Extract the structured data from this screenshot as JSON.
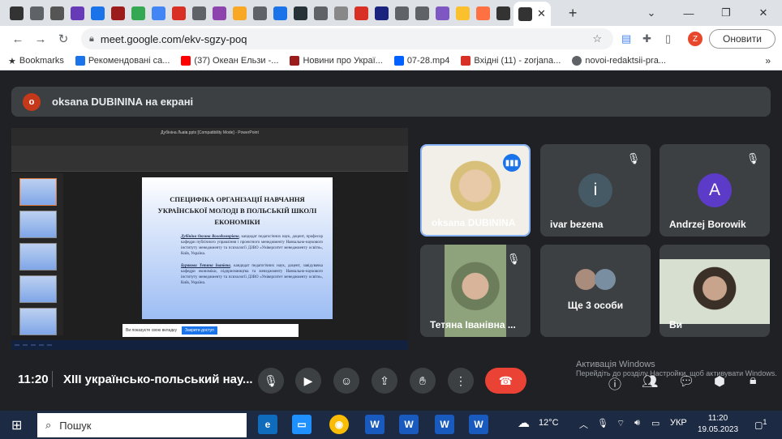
{
  "browser": {
    "url": "meet.google.com/ekv-sgzy-poq",
    "update_label": "Оновити",
    "profile_initial": "Z",
    "bookmarks": [
      {
        "label": "Bookmarks",
        "color": "#555"
      },
      {
        "label": "Рекомендовані са...",
        "color": "#1a73e8"
      },
      {
        "label": "(37) Океан Ельзи -...",
        "color": "#ff0000"
      },
      {
        "label": "Новини про Украї...",
        "color": "#9c1c1c"
      },
      {
        "label": "07-28.mp4",
        "color": "#0061fe"
      },
      {
        "label": "Вхідні (11) - zorjana...",
        "color": "#d93025"
      },
      {
        "label": "novoi-redaktsii-pra...",
        "color": "#5f6368"
      }
    ]
  },
  "meet": {
    "presenter_banner": "oksana DUBININA на екрані",
    "presenter_initial": "o",
    "time": "11:20",
    "meeting_title": "XIII українсько-польський нау...",
    "participants": [
      {
        "name": "oksana DUBININA"
      },
      {
        "name": "ivar bezena",
        "initial": "i"
      },
      {
        "name": "Andrzej Borowik",
        "initial": "A"
      },
      {
        "name": "Тетяна Іванівна ..."
      },
      {
        "name": "Ще 3 особи"
      },
      {
        "name": "Ви"
      }
    ],
    "colors": {
      "hangup": "#ea4335",
      "accent": "#1a73e8"
    }
  },
  "slide": {
    "title": "СПЕЦИФІКА ОРГАНІЗАЦІЇ НАВЧАННЯ УКРАЇНСЬКОЇ МОЛОДІ В ПОЛЬСЬКІЙ ШКОЛІ ЕКОНОМІКИ",
    "author1_name": "Дубініна Оксана Володимирівна",
    "author1_text": ", кандидат педагогічних наук, доцент, професор кафедри публічного управління і проектного менеджменту Навчально-наукового інституту менеджменту та психології ДЗВО «Університет менеджменту освіти», Київ, Україна.",
    "author2_name": "Буракова Тетяна Іванівна",
    "author2_text": ", кандидат педагогічних наук, доцент, завідувачка кафедри економіки, підприємництва та менеджменту Навчально-наукового інституту менеджменту та психології ДЗВО «Університет менеджменту освіти», Київ, Україна.",
    "notice": "Ви показуєте свою вкладку",
    "notice_btn": "Закрити доступ",
    "ppt_title": "Дубініна Львів.pptx [Compatibility Mode] - PowerPoint"
  },
  "os": {
    "activation_title": "Активація Windows",
    "activation_sub": "Перейдіть до розділу Настройки, щоб активувати Windows.",
    "search_placeholder": "Пошук",
    "weather": "12°C",
    "lang": "УКР",
    "clock_time": "11:20",
    "clock_date": "19.05.2023",
    "notif_count": "1"
  }
}
